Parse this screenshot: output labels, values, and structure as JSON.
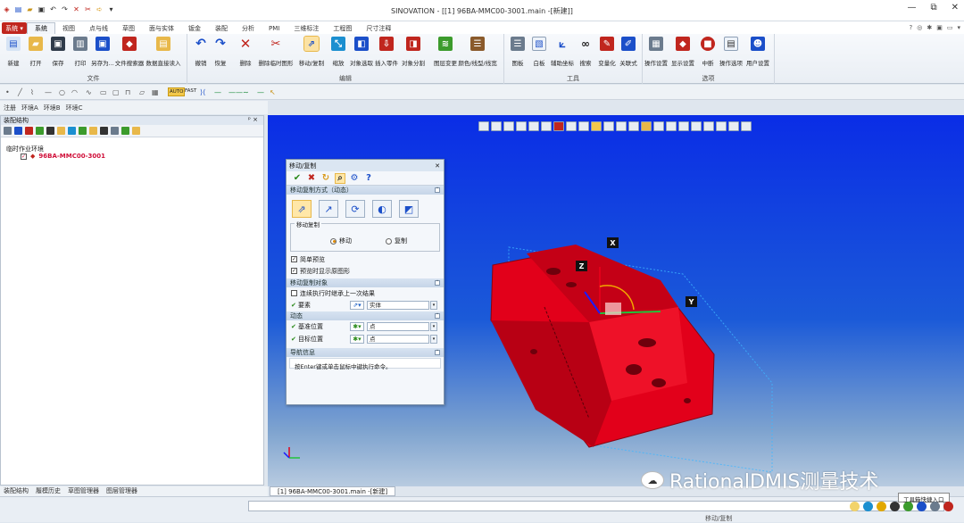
{
  "window": {
    "title": "SINOVATION - [[1] 96BA-MMC00-3001.main -[新建]]",
    "controls": [
      "—",
      "⧉",
      "✕"
    ]
  },
  "menu": {
    "system": "系统",
    "tabs": [
      "系统",
      "视图",
      "点与线",
      "草图",
      "面与实体",
      "钣金",
      "装配",
      "分析",
      "PMI",
      "三维标注",
      "工程图",
      "尺寸注释"
    ],
    "active_index": 0
  },
  "ribbon": {
    "groups": [
      {
        "label": "文件",
        "items": [
          "新建",
          "打开",
          "保存",
          "打印",
          "另存为...",
          "文件搜索器",
          "数据直接读入"
        ]
      },
      {
        "label": "编辑",
        "items": [
          "撤销",
          "恢复",
          "删除",
          "删除临时图形",
          "移动/复制",
          "缩放",
          "对象选取",
          "插入零件",
          "对象分割",
          "图层变更",
          "颜色/线型/线宽"
        ]
      },
      {
        "label": "工具",
        "items": [
          "图板",
          "白板",
          "辅助坐标",
          "搜索",
          "变量化",
          "关联式"
        ]
      },
      {
        "label": "选项",
        "items": [
          "操作设置",
          "显示设置",
          "中断",
          "操作选项",
          "用户设置"
        ]
      }
    ]
  },
  "toolbar2": {
    "auto": "AUTO",
    "fast": "FAST"
  },
  "env_tabs": [
    "注册",
    "环境A",
    "环境B",
    "环境C"
  ],
  "left_panel": {
    "title": "装配结构",
    "pin": "ᵖ ×",
    "tree": {
      "root": "临时作业环境",
      "child": "96BA-MMC00-3001"
    }
  },
  "left_bottom_tabs": [
    "装配结构",
    "履模历史",
    "草图管理器",
    "图层管理器"
  ],
  "document_tab": "[1] 96BA-MMC00-3001.main -[新建]",
  "axis_labels": {
    "x": "X",
    "y": "Y",
    "z": "Z"
  },
  "dialog": {
    "title": "移动/复制",
    "section1": "移动复制方式（动态）",
    "fieldset": "移动复制",
    "radio_move": "移动",
    "radio_copy": "复制",
    "check_simple": "简单预览",
    "check_preview": "预览时显示原图形",
    "section2": "移动复制对象",
    "check_continue": "连续执行时继承上一次结果",
    "field_element": "要素",
    "element_value": "实体",
    "section3": "动态",
    "field_base": "基准位置",
    "base_value": "点",
    "field_target": "目标位置",
    "target_value": "点",
    "section4": "导航信息",
    "hint": "按Enter键或单击鼠标中键执行命令。"
  },
  "status": {
    "text": "移动/复制"
  },
  "watermark": "RationalDMIS测量技术",
  "tooltip": "工具箱快捷入口",
  "colors": {
    "accent": "#c0261e",
    "viewport_top": "#0a2de6",
    "part": "#e2001a"
  }
}
